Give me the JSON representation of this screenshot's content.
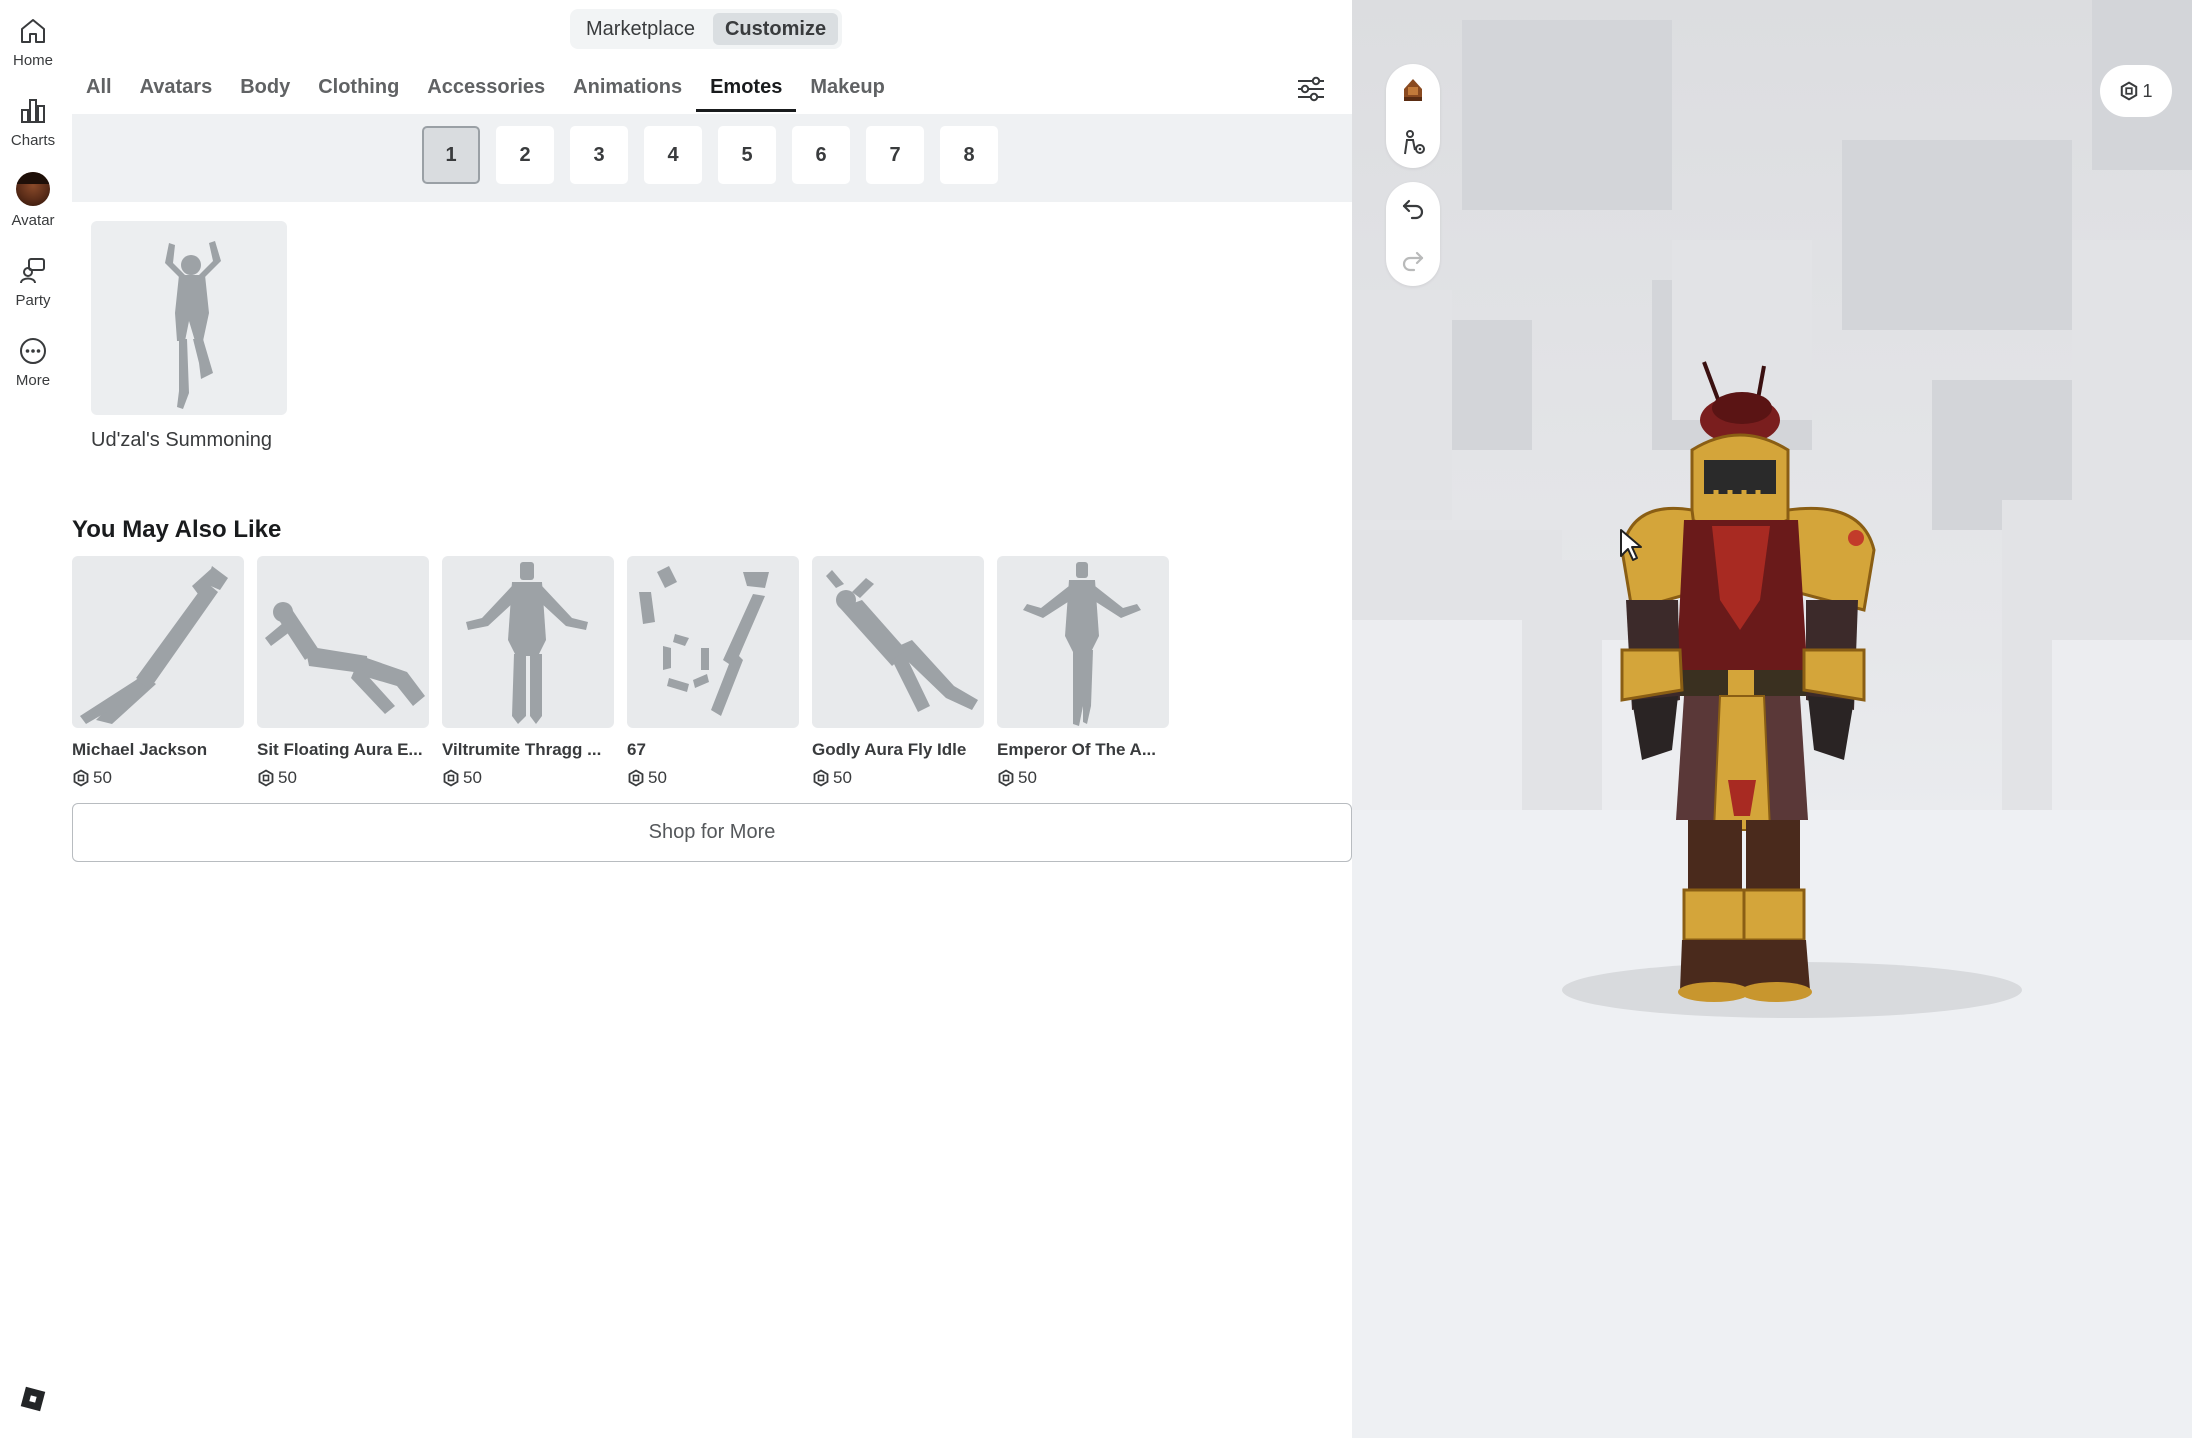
{
  "nav": {
    "items": [
      {
        "label": "Home",
        "icon": "home-icon"
      },
      {
        "label": "Charts",
        "icon": "charts-icon"
      },
      {
        "label": "Avatar",
        "icon": "avatar-icon"
      },
      {
        "label": "Party",
        "icon": "party-icon"
      },
      {
        "label": "More",
        "icon": "more-icon"
      }
    ]
  },
  "top_toggle": {
    "marketplace": "Marketplace",
    "customize": "Customize",
    "active": "Customize"
  },
  "tabs": [
    "All",
    "Avatars",
    "Body",
    "Clothing",
    "Accessories",
    "Animations",
    "Emotes",
    "Makeup"
  ],
  "active_tab": "Emotes",
  "slots": [
    "1",
    "2",
    "3",
    "4",
    "5",
    "6",
    "7",
    "8"
  ],
  "active_slot": "1",
  "equipped": {
    "name": "Ud'zal's Summoning"
  },
  "recommendations": {
    "title": "You May Also Like",
    "items": [
      {
        "name": "Michael Jackson",
        "price": "50"
      },
      {
        "name": "Sit Floating Aura E...",
        "price": "50"
      },
      {
        "name": "Viltrumite Thragg ...",
        "price": "50"
      },
      {
        "name": "67",
        "price": "50"
      },
      {
        "name": "Godly Aura Fly Idle",
        "price": "50"
      },
      {
        "name": "Emperor Of The A...",
        "price": "50"
      }
    ],
    "shop_more": "Shop for More"
  },
  "viewport": {
    "robux_count": "1"
  },
  "colors": {
    "accent_dark": "#191b1d",
    "text": "#393b3d",
    "slot_bar_bg": "#eff1f3",
    "thumb_bg": "#e8eaec",
    "silhouette": "#9da2a6",
    "armor_gold": "#d4a53a",
    "armor_red": "#7a1e1e"
  }
}
